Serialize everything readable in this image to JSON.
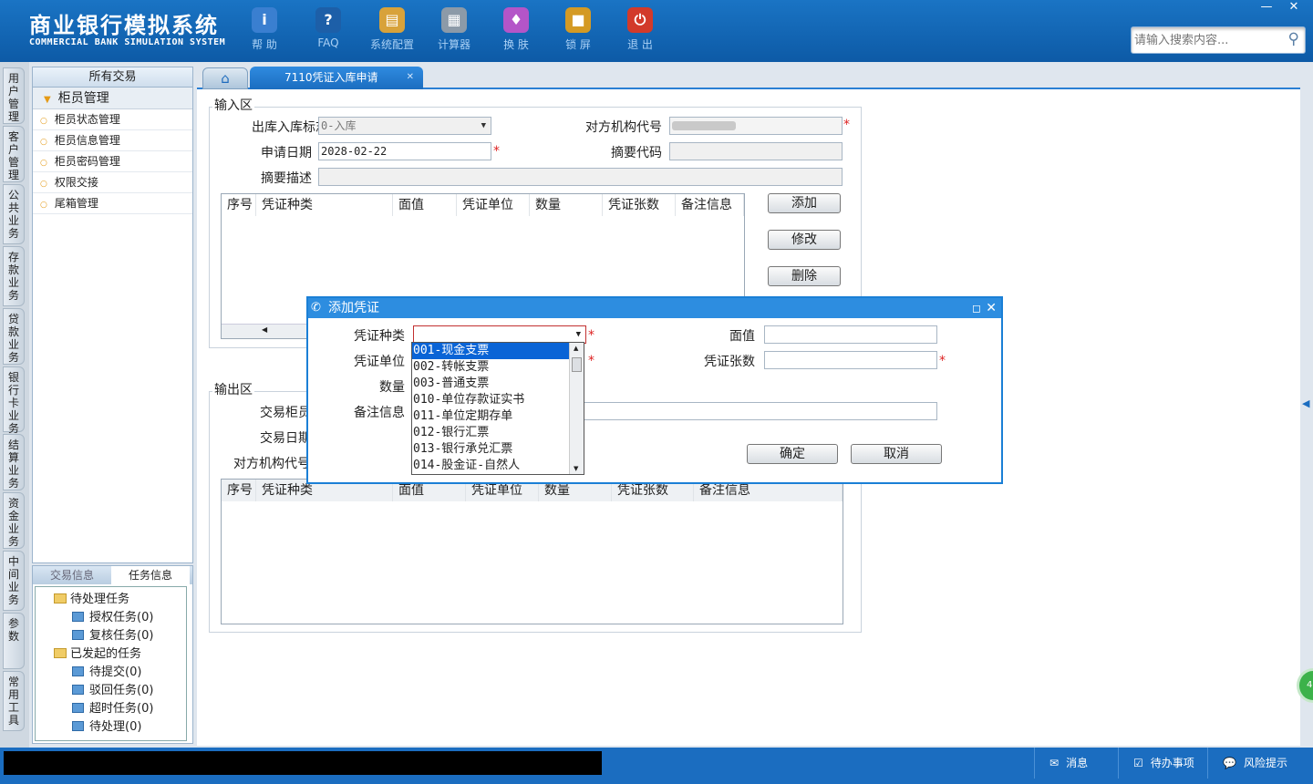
{
  "app": {
    "title": "商业银行模拟系统",
    "subtitle": "COMMERCIAL BANK SIMULATION SYSTEM"
  },
  "toolbar": [
    {
      "label": "帮 助",
      "icon": "info-icon",
      "glyph": "i",
      "color": "#3a7fd0"
    },
    {
      "label": "FAQ",
      "icon": "help-icon",
      "glyph": "?",
      "color": "#1d5fa8"
    },
    {
      "label": "系统配置",
      "icon": "toolbox-icon",
      "glyph": "▤",
      "color": "#d8a23a"
    },
    {
      "label": "计算器",
      "icon": "calculator-icon",
      "glyph": "▦",
      "color": "#8c9aa8"
    },
    {
      "label": "换 肤",
      "icon": "shirt-icon",
      "glyph": "♦",
      "color": "#b455c8"
    },
    {
      "label": "锁 屏",
      "icon": "lock-icon",
      "glyph": "■",
      "color": "#d49a24"
    },
    {
      "label": "退 出",
      "icon": "power-icon",
      "glyph": "⏻",
      "color": "#d23a2a"
    }
  ],
  "search": {
    "placeholder": "请输入搜索内容..."
  },
  "side_tabs": [
    "用户管理",
    "客户管理",
    "公共业务",
    "存款业务",
    "贷款业务",
    "银行卡业务",
    "结算业务",
    "资金业务",
    "中间业务",
    "参数",
    "常用工具"
  ],
  "menu": {
    "header": "所有交易",
    "group": "柜员管理",
    "items": [
      "柜员状态管理",
      "柜员信息管理",
      "柜员密码管理",
      "权限交接",
      "尾箱管理"
    ]
  },
  "task_panel": {
    "tabs": [
      "交易信息",
      "任务信息"
    ],
    "pending": "待处理任务",
    "pending_items": [
      "授权任务(0)",
      "复核任务(0)"
    ],
    "initiated": "已发起的任务",
    "initiated_items": [
      "待提交(0)",
      "驳回任务(0)",
      "超时任务(0)",
      "待处理(0)"
    ]
  },
  "tabs": {
    "active": "7110凭证入库申请"
  },
  "input_section": {
    "title": "输入区",
    "direction_label": "出库入库标志",
    "direction_value": "0-入库",
    "counterparty_label": "对方机构代号",
    "apply_date_label": "申请日期",
    "apply_date_value": "2028-02-22",
    "summary_code_label": "摘要代码",
    "summary_desc_label": "摘要描述",
    "columns": [
      "序号",
      "凭证种类",
      "面值",
      "凭证单位",
      "数量",
      "凭证张数",
      "备注信息"
    ],
    "buttons": {
      "add": "添加",
      "modify": "修改",
      "delete": "删除"
    }
  },
  "output_section": {
    "title": "输出区",
    "teller_label": "交易柜员",
    "date_label": "交易日期",
    "counterparty_label": "对方机构代号",
    "columns": [
      "序号",
      "凭证种类",
      "面值",
      "凭证单位",
      "数量",
      "凭证张数",
      "备注信息"
    ]
  },
  "dialog": {
    "title": "添加凭证",
    "type_label": "凭证种类",
    "face_label": "面值",
    "unit_label": "凭证单位",
    "count_label": "凭证张数",
    "qty_label": "数量",
    "remark_label": "备注信息",
    "ok": "确定",
    "cancel": "取消",
    "options": [
      "001-现金支票",
      "002-转帐支票",
      "003-普通支票",
      "010-单位存款证实书",
      "011-单位定期存单",
      "012-银行汇票",
      "013-银行承兑汇票",
      "014-股金证-自然人"
    ],
    "selected_index": 0
  },
  "statusbar": {
    "messages": "消息",
    "todo": "待办事项",
    "risk": "风险提示"
  }
}
